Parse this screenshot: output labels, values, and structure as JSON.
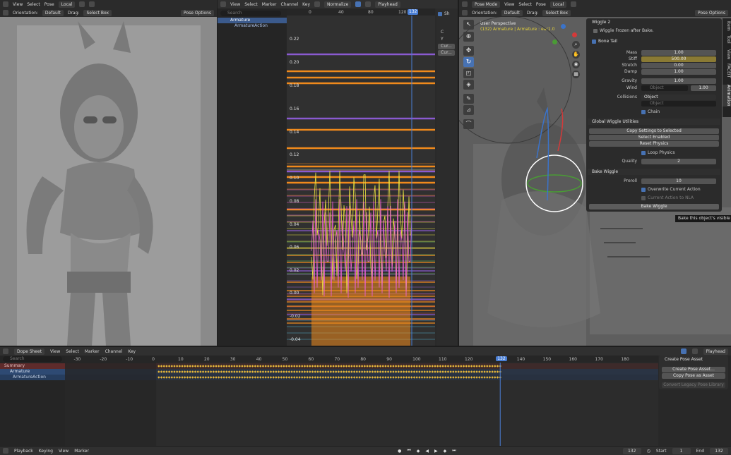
{
  "left_viewport": {
    "menu": [
      "View",
      "Select",
      "Pose"
    ],
    "transform_orientation": "Local",
    "orientation_label": "Orientation:",
    "orientation_value": "Default",
    "drag_label": "Drag:",
    "drag_value": "Select Box",
    "pose_options": "Pose Options"
  },
  "graph_editor": {
    "menu": [
      "View",
      "Select",
      "Marker",
      "Channel",
      "Key"
    ],
    "normalize": "Normalize",
    "playhead": "Playhead",
    "search_placeholder": "Search",
    "channels": [
      "Armature",
      "ArmatureAction"
    ],
    "frame_ticks": [
      "0",
      "40",
      "80",
      "120"
    ],
    "current_frame": "132",
    "y_ticks": [
      "0.22",
      "0.20",
      "0.18",
      "0.16",
      "0.14",
      "0.12",
      "0.10",
      "0.08",
      "0.06",
      "0.04",
      "0.02",
      "0.00",
      "-0.02",
      "-0.04"
    ],
    "side_labels": [
      "Sh",
      "C",
      "Y",
      "Cur...",
      "Cur..."
    ]
  },
  "right_viewport": {
    "mode": "Pose Mode",
    "menu": [
      "View",
      "Select",
      "Pose"
    ],
    "transform_orientation": "Local",
    "orientation_label": "Orientation:",
    "orientation_value": "Default",
    "drag_label": "Drag:",
    "drag_value": "Select Box",
    "pose_options": "Pose Options",
    "perspective": "User Perspective",
    "object_info": "(132) Armature | Armature : ear1.0",
    "side_tabs": [
      "Item",
      "Tool",
      "View",
      "FACEIT",
      "Animation"
    ],
    "tooltip": "Bake this object's visible wigg"
  },
  "wiggle_panel": {
    "title": "Wiggle 2",
    "frozen_label": "Wiggle Frozen after Bake.",
    "bone_tail": "Bone Tail",
    "props": [
      {
        "label": "Mass",
        "value": "1.00"
      },
      {
        "label": "Stiff",
        "value": "500.00"
      },
      {
        "label": "Stretch",
        "value": "0.00"
      },
      {
        "label": "Damp",
        "value": "1.00"
      }
    ],
    "gravity_label": "Gravity",
    "gravity_value": "1.00",
    "wind_label": "Wind",
    "wind_placeholder": "Object",
    "wind_value": "1.00",
    "collisions_label": "Collisions",
    "collisions_value": "Object",
    "collisions_placeholder": "Object",
    "chain_label": "Chain",
    "global_title": "Global Wiggle Utilities",
    "copy_settings": "Copy Settings to Selected",
    "select_enabled": "Select Enabled",
    "reset_physics": "Reset Physics",
    "loop_physics": "Loop Physics",
    "quality_label": "Quality",
    "quality_value": "2",
    "bake_title": "Bake Wiggle",
    "preroll_label": "Preroll",
    "preroll_value": "10",
    "overwrite_label": "Overwrite Current Action",
    "nla_label": "Current Action to NLA",
    "bake_button": "Bake Wiggle"
  },
  "dope_sheet": {
    "mode": "Dope Sheet",
    "menu": [
      "View",
      "Select",
      "Marker",
      "Channel",
      "Key"
    ],
    "playhead": "Playhead",
    "search_placeholder": "Search",
    "channels": [
      "Summary",
      "Armature",
      "ArmatureAction"
    ],
    "frame_ticks": [
      "-30",
      "-20",
      "-10",
      "0",
      "10",
      "20",
      "30",
      "40",
      "50",
      "60",
      "70",
      "80",
      "90",
      "100",
      "110",
      "120",
      "132",
      "140",
      "150",
      "160",
      "170",
      "180"
    ],
    "current_frame": "132",
    "pose_asset": {
      "title": "Create Pose Asset",
      "create": "Create Pose Asset...",
      "copy": "Copy Pose as Asset",
      "convert": "Convert Legacy Pose Library"
    }
  },
  "timeline": {
    "menu": [
      "Playback",
      "Keying",
      "View",
      "Marker"
    ],
    "current": "132",
    "start_label": "Start",
    "start_value": "1",
    "end_label": "End",
    "end_value": "132"
  },
  "colors": {
    "accent": "#4772b3",
    "playhead": "#4a7fd6",
    "curve_orange": "#f08a1c",
    "keyframe": "#e8b83a"
  }
}
